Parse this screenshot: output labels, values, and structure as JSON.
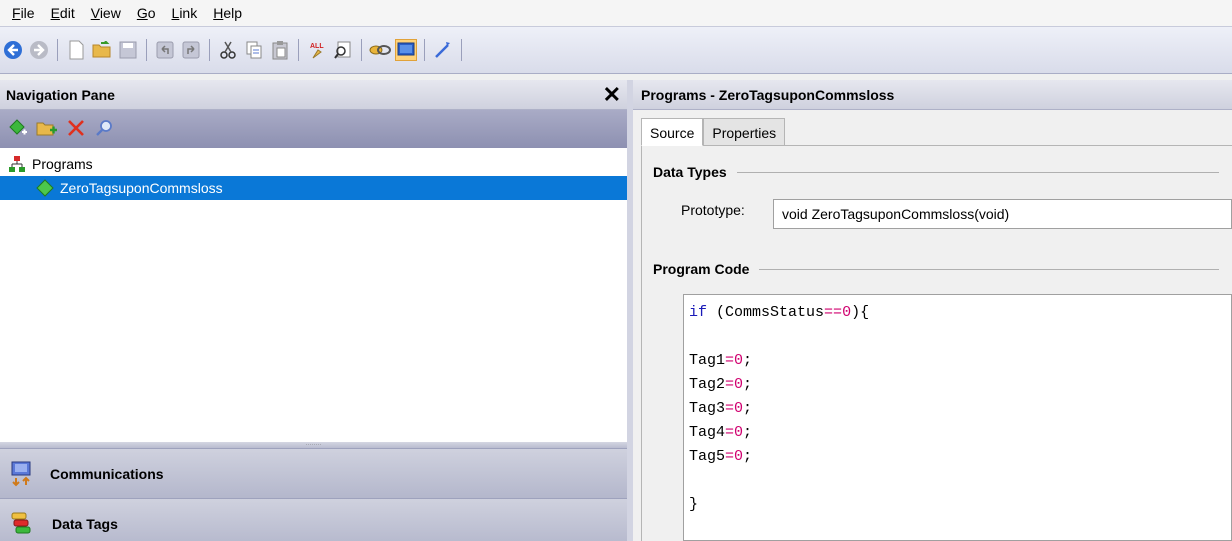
{
  "menu": {
    "items": [
      {
        "mnemonic": "F",
        "rest": "ile"
      },
      {
        "mnemonic": "E",
        "rest": "dit"
      },
      {
        "mnemonic": "V",
        "rest": "iew"
      },
      {
        "mnemonic": "G",
        "rest": "o"
      },
      {
        "mnemonic": "L",
        "rest": "ink"
      },
      {
        "mnemonic": "H",
        "rest": "elp"
      }
    ]
  },
  "nav_pane": {
    "title": "Navigation Pane",
    "close_glyph": "✕",
    "tree": {
      "root_label": "Programs",
      "child_label": "ZeroTagsuponCommsloss"
    },
    "bottom_panes": [
      {
        "label": "Communications",
        "icon": "communications-icon"
      },
      {
        "label": "Data Tags",
        "icon": "data-tags-icon"
      }
    ]
  },
  "editor": {
    "title": "Programs - ZeroTagsuponCommsloss",
    "tabs": [
      "Source",
      "Properties"
    ],
    "selected_tab": "Source",
    "data_types_title": "Data Types",
    "prototype_label": "Prototype:",
    "prototype_value": "void ZeroTagsuponCommsloss(void)",
    "program_code_title": "Program Code",
    "code": {
      "line1": {
        "kw": "if",
        "pre": " (CommsStatus",
        "op": "==",
        "num": "0",
        "post": "){"
      },
      "tags": [
        {
          "name": "Tag1",
          "op": "=",
          "num": "0",
          "end": ";"
        },
        {
          "name": "Tag2",
          "op": "=",
          "num": "0",
          "end": ";"
        },
        {
          "name": "Tag3",
          "op": "=",
          "num": "0",
          "end": ";"
        },
        {
          "name": "Tag4",
          "op": "=",
          "num": "0",
          "end": ";"
        },
        {
          "name": "Tag5",
          "op": "=",
          "num": "0",
          "end": ";"
        }
      ],
      "close": "}"
    }
  },
  "colors": {
    "selection": "#0a78d7",
    "keyword": "#1a1ab8",
    "operator": "#d0006f"
  }
}
